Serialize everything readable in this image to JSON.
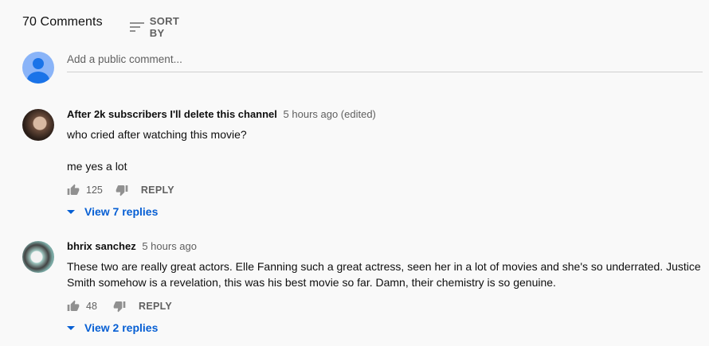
{
  "header": {
    "count_label": "70 Comments",
    "sort_label": "SORT BY",
    "sort_icon": "sort-icon"
  },
  "add_comment": {
    "placeholder": "Add a public comment...",
    "avatar_icon": "default-user-avatar-icon"
  },
  "comments": [
    {
      "author": "After 2k subscribers I'll delete this channel",
      "time": "5 hours ago (edited)",
      "text": "who cried after watching this movie?\n\nme yes a lot",
      "likes": "125",
      "reply_label": "REPLY",
      "view_replies": "View 7 replies"
    },
    {
      "author": "bhrix sanchez",
      "time": "5 hours ago",
      "text": "These two are really great actors. Elle Fanning such a great actress, seen her in a lot of movies and she's so underrated. Justice Smith somehow is a revelation, this was his best movie so far. Damn, their chemistry is so genuine.",
      "likes": "48",
      "reply_label": "REPLY",
      "view_replies": "View 2 replies"
    }
  ],
  "colors": {
    "link_blue": "#065fd4",
    "secondary_text": "#606060",
    "background": "#f9f9f9"
  }
}
